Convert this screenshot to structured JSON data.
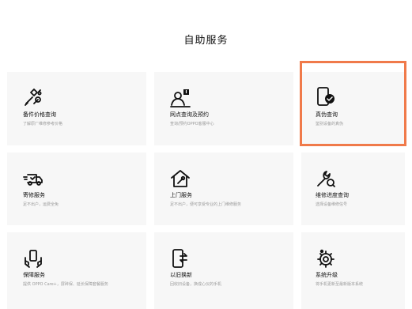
{
  "page_title": "自助服务",
  "cards": [
    {
      "label": "备件价格查询",
      "desc": "了解原厂维修参考价格",
      "icon": "tools-icon"
    },
    {
      "label": "网点查询及预约",
      "desc": "查询/预约OPPO客服中心",
      "icon": "service-center-icon"
    },
    {
      "label": "真伪查询",
      "desc": "鉴别设备的真伪",
      "icon": "phone-verified-icon"
    },
    {
      "label": "寄修服务",
      "desc": "足不出户，运费全免",
      "icon": "delivery-truck-icon"
    },
    {
      "label": "上门服务",
      "desc": "足不出户，便可享受专业的上门维修服务",
      "icon": "home-repair-icon"
    },
    {
      "label": "维修进度查询",
      "desc": "选择设备维修信号",
      "icon": "wrench-search-icon"
    },
    {
      "label": "保障服务",
      "desc": "提供 OPPO Care+，屏碎保、延长保障套餐服务",
      "icon": "hands-phone-icon"
    },
    {
      "label": "以旧换新",
      "desc": "回收旧设备，换成心仪的手机",
      "icon": "trade-in-icon"
    },
    {
      "label": "系统升级",
      "desc": "将手机更新至最新版本系统",
      "icon": "system-gear-icon"
    }
  ],
  "colors": {
    "highlight": "#f07a4a",
    "card_bg": "#f7f7f7"
  }
}
